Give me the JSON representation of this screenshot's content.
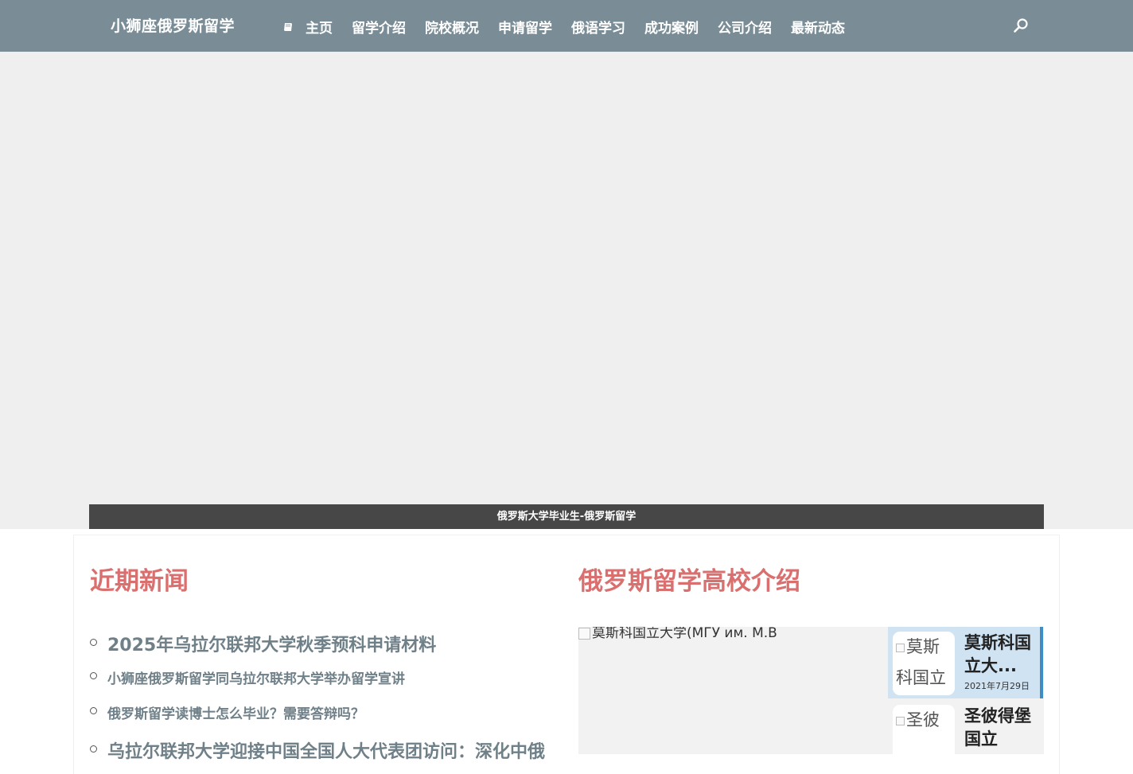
{
  "header": {
    "brand": "小狮座俄罗斯留学",
    "nav": [
      {
        "label": "主页",
        "icon": "book-icon"
      },
      {
        "label": "留学介绍"
      },
      {
        "label": "院校概况"
      },
      {
        "label": "申请留学"
      },
      {
        "label": "俄语学习"
      },
      {
        "label": "成功案例"
      },
      {
        "label": "公司介绍"
      },
      {
        "label": "最新动态"
      }
    ],
    "search_icon": "search-icon"
  },
  "banner": {
    "caption": "俄罗斯大学毕业生-俄罗斯留学"
  },
  "news": {
    "title": "近期新闻",
    "items": [
      "2025年乌拉尔联邦大学秋季预科申请材料",
      "小狮座俄罗斯留学同乌拉尔联邦大学举办留学宣讲",
      "俄罗斯留学读博士怎么毕业？需要答辩吗？",
      "乌拉尔联邦大学迎接中国全国人大代表团访问：深化中俄"
    ]
  },
  "schools": {
    "title": "俄罗斯留学高校介绍",
    "main_alt": "莫斯科国立大学(МГУ им. М.В",
    "thumbs": [
      {
        "img_alt": "莫斯科国立",
        "title": "莫斯科国立大...",
        "date": "2021年7月29日"
      },
      {
        "img_alt": "圣彼",
        "title": "圣彼得堡国立",
        "date": ""
      }
    ]
  },
  "colors": {
    "header_bg": "#7a8d97",
    "accent_title": "#d9706f",
    "news_link": "#6f8088",
    "active_thumb": "#cfe3f3",
    "active_border": "#3e8dc5"
  }
}
